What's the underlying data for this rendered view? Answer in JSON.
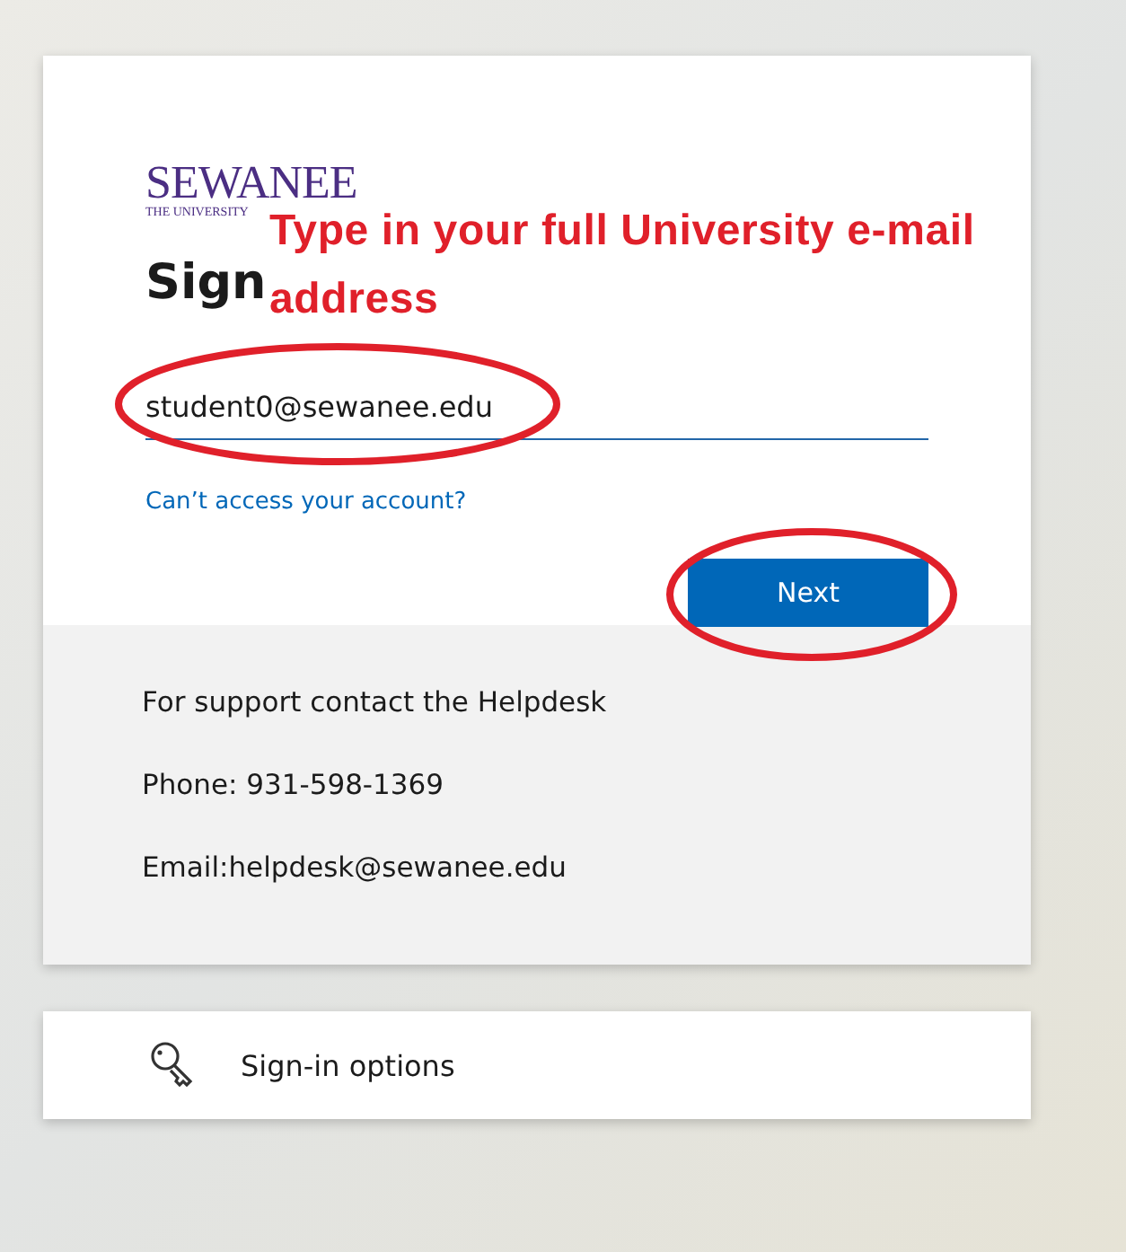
{
  "logo": {
    "name": "SEWANEE",
    "subtitle": "THE UNIVERSITY"
  },
  "heading": "Sign",
  "annotation": "Type in your full University e-mail address",
  "email_field": {
    "value": "student0@sewanee.edu"
  },
  "help_link": "Can’t access your account?",
  "next_button": "Next",
  "footer": [
    "For support contact the Helpdesk",
    "Phone: 931-598-1369",
    "Email:helpdesk@sewanee.edu"
  ],
  "sign_in_options": "Sign-in options"
}
